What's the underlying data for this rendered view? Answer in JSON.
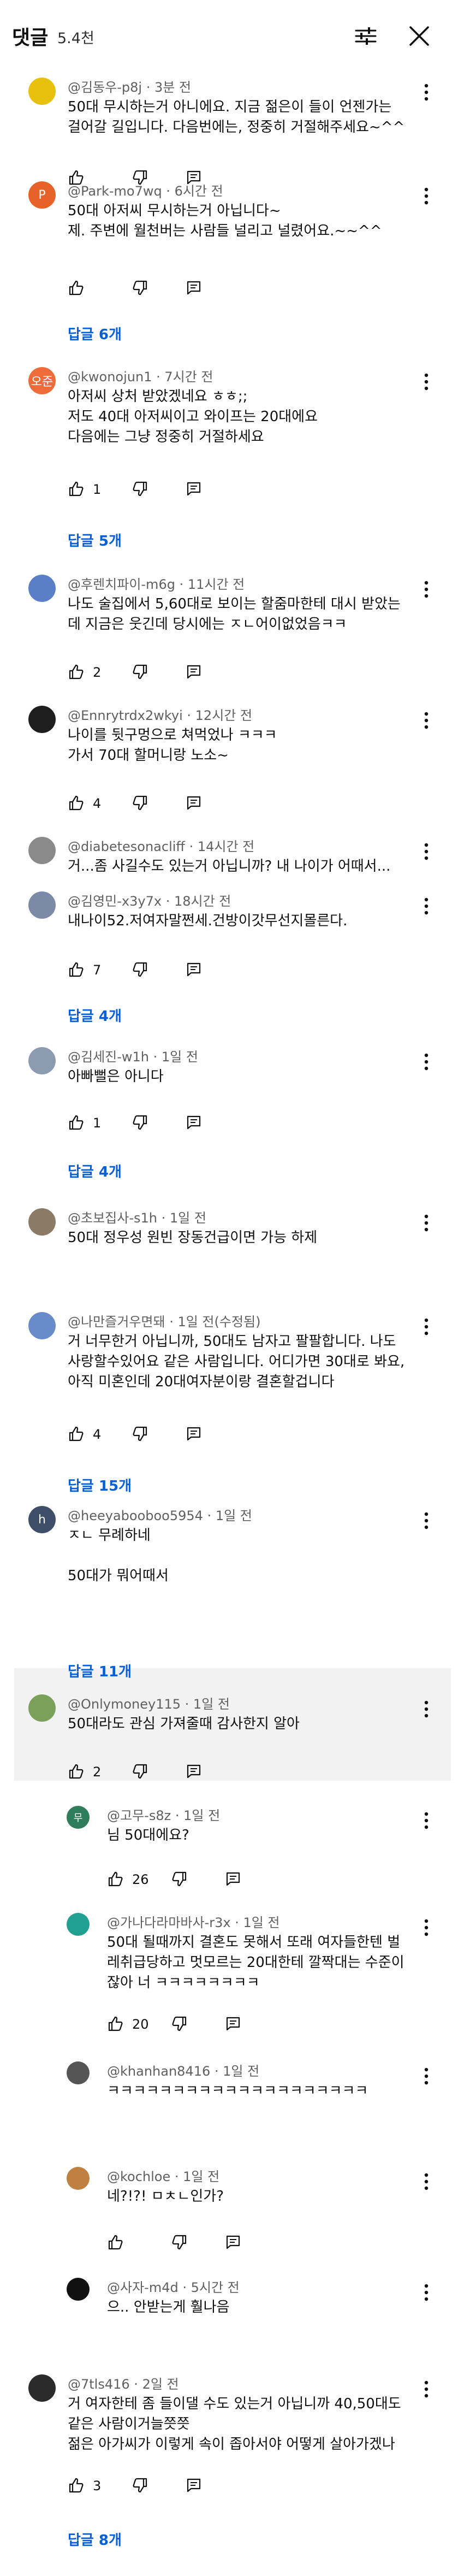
{
  "header": {
    "title": "댓글",
    "count": "5.4천",
    "filter_icon": "sliders-icon",
    "close_icon": "close-icon"
  },
  "comments": [
    {
      "author": "@김동우-p8j",
      "time": "3분 전",
      "text": "50대 무시하는거 아니에요. 지금 젊은이 들이 언젠가는\n걸어갈 길입니다. 다음번에는, 정중히 거절해주세요~^^",
      "likes": "",
      "avatar_color": "#e8c10e",
      "avatar_letter": ""
    },
    {
      "author": "@Park-mo7wq",
      "time": "6시간 전",
      "text": "50대 아저씨 무시하는거 아닙니다~\n제. 주변에 월천버는 사람들 널리고 널렸어요.~~^^",
      "likes": "",
      "replies": "답글 6개",
      "avatar_color": "#e76229",
      "avatar_letter": "P"
    },
    {
      "author": "@kwonojun1",
      "time": "7시간 전",
      "text": "아저씨 상처 받았겠네요 ㅎㅎ;;\n저도 40대 아저씨이고 와이프는 20대에요\n다음에는 그냥 정중히 거절하세요",
      "likes": "1",
      "replies": "답글 5개",
      "avatar_color": "#ef6c3a",
      "avatar_letter": "오준"
    },
    {
      "author": "@후렌치파이-m6g",
      "time": "11시간 전",
      "text": "나도 술집에서 5,60대로 보이는 할줌마한테 대시 받았는\n데 지금은 웃긴데 당시에는 ㅈㄴ어이없었음ㅋㅋ",
      "likes": "2",
      "avatar_color": "#5b7fc7",
      "avatar_letter": ""
    },
    {
      "author": "@Ennrytrdx2wkyi",
      "time": "12시간 전",
      "text": "나이를 뒷구멍으로 쳐먹었나 ㅋㅋㅋ\n가서 70대 할머니랑 노소~",
      "likes": "4",
      "avatar_color": "#1e1e1e",
      "avatar_letter": ""
    },
    {
      "author": "@diabetesonacliff",
      "time": "14시간 전",
      "text": "거...좀 사길수도 있는거 아닙니까? 내 나이가 어때서...",
      "likes": "",
      "avatar_color": "#8a8a8a",
      "avatar_letter": ""
    },
    {
      "author": "@김영민-x3y7x",
      "time": "18시간 전",
      "text": "내나이52.저여자말쩐세.건방이갓무선지몰른다.",
      "likes": "7",
      "replies": "답글 4개",
      "avatar_color": "#7c8aa8",
      "avatar_letter": ""
    },
    {
      "author": "@김세진-w1h",
      "time": "1일 전",
      "text": "아빠뻘은 아니다",
      "likes": "1",
      "replies": "답글 4개",
      "avatar_color": "#8c9bb0",
      "avatar_letter": ""
    },
    {
      "author": "@초보집사-s1h",
      "time": "1일 전",
      "text": "50대  정우성 원빈 장동건급이면 가능 하제",
      "likes": "",
      "avatar_color": "#8a7a66",
      "avatar_letter": ""
    },
    {
      "author": "@나만즐거우면돼",
      "time": "1일 전(수정됨)",
      "text": "거 너무한거 아닙니까, 50대도 남자고 팔팔합니다. 나도\n사랑할수있어요 같은 사람입니다. 어디가면 30대로 봐요,\n아직 미혼인데 20대여자분이랑 결혼할겁니다",
      "likes": "4",
      "replies": "답글 15개",
      "avatar_color": "#6a8bc9",
      "avatar_letter": ""
    },
    {
      "author": "@heeyabooboo5954",
      "time": "1일 전",
      "text": "ㅈㄴ 무례하네\n\n50대가 뭐어때서",
      "likes": "",
      "replies": "답글 11개",
      "avatar_color": "#3f4f6a",
      "avatar_letter": "h"
    },
    {
      "author": "@Onlymoney115",
      "time": "1일 전",
      "text": "50대라도 관심 가져줄때 감사한지 알아",
      "likes": "2",
      "avatar_color": "#7aa05a",
      "avatar_letter": ""
    }
  ],
  "replies_thread": [
    {
      "author": "@고무-s8z",
      "time": "1일 전",
      "text": "님 50대에요?",
      "likes": "26",
      "avatar_color": "#2e7d5b",
      "avatar_letter": "무"
    },
    {
      "author": "@가나다라마바사-r3x",
      "time": "1일 전",
      "text": "50대 될때까지 결혼도 못해서 또래 여자들한텐 벌\n레취급당하고 멋모르는 20대한테 깔짝대는 수준이\n잖아 너 ㅋㅋㅋㅋㅋㅋㅋㅋ",
      "likes": "20",
      "avatar_color": "#20a090",
      "avatar_letter": ""
    },
    {
      "author": "@khanhan8416",
      "time": "1일 전",
      "text": "ㅋㅋㅋㅋㅋㅋㅋㅋㅋㅋㅋㅋㅋㅋㅋㅋㅋㅋㅋㅋ",
      "likes": "",
      "avatar_color": "#555555",
      "avatar_letter": ""
    },
    {
      "author": "@kochloe",
      "time": "1일 전",
      "text": "네?!?! ㅁㅊㄴ인가?",
      "likes": "",
      "avatar_color": "#c08040",
      "avatar_letter": ""
    },
    {
      "author": "@사자-m4d",
      "time": "5시간 전",
      "text": "으.. 안받는게 훨나음",
      "likes": "",
      "avatar_color": "#111111",
      "avatar_letter": ""
    }
  ],
  "last_comment": {
    "author": "@7tls416",
    "time": "2일 전",
    "text": "거 여자한테 좀 들이댈 수도 있는거 아닙니까 40,50대도\n같은 사람이거늘쯧쯧\n젊은 아가씨가 이렇게 속이 좁아서야 어떻게 살아가겠나",
    "likes": "3",
    "replies": "답글 8개",
    "avatar_color": "#2b2b2b",
    "avatar_letter": ""
  },
  "icons": {
    "like": "thumbs-up-icon",
    "dislike": "thumbs-down-icon",
    "reply": "reply-icon",
    "menu": "kebab-menu-icon"
  }
}
